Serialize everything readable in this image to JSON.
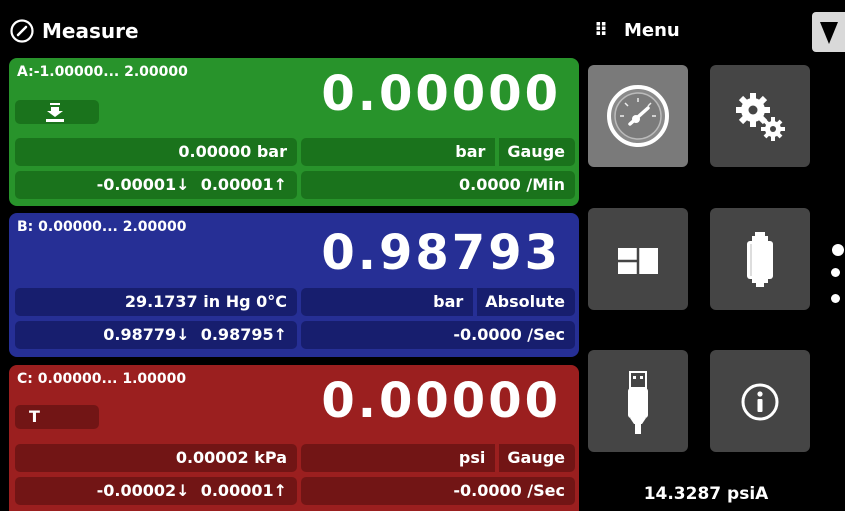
{
  "header": {
    "title": "Measure",
    "menu_label": "Menu",
    "menu_dots": "⠿",
    "dropdown_icon": "down-triangle-icon"
  },
  "channels": [
    {
      "id": "A",
      "range": "A:-1.00000... 2.00000",
      "reading": "0.00000",
      "aux_value": "0.00000 bar",
      "unit": "bar",
      "mode": "Gauge",
      "min": "-0.00001↓",
      "max": "0.00001↑",
      "rate": "0.0000 /Min",
      "button_icon": "tare-arrow-icon",
      "color": "#28932b"
    },
    {
      "id": "B",
      "range": "B: 0.00000... 2.00000",
      "reading": "0.98793",
      "aux_value": "29.1737 in Hg 0°C",
      "unit": "bar",
      "mode": "Absolute",
      "min": "0.98779↓",
      "max": "0.98795↑",
      "rate": "-0.0000 /Sec",
      "color": "#262f95"
    },
    {
      "id": "C",
      "range": "C: 0.00000... 1.00000",
      "reading": "0.00000",
      "button_label": "T",
      "aux_value": "0.00002 kPa",
      "unit": "psi",
      "mode": "Gauge",
      "min": "-0.00002↓",
      "max": "0.00001↑",
      "rate": "-0.0000 /Sec",
      "color": "#9b1f1f"
    }
  ],
  "menu_tiles": [
    {
      "name": "measure",
      "icon": "gauge-icon",
      "selected": true
    },
    {
      "name": "settings",
      "icon": "gears-icon",
      "selected": false
    },
    {
      "name": "display",
      "icon": "display-layout-icon",
      "selected": false
    },
    {
      "name": "sensor",
      "icon": "transducer-icon",
      "selected": false
    },
    {
      "name": "usb",
      "icon": "usb-icon",
      "selected": false
    },
    {
      "name": "info",
      "icon": "info-icon",
      "selected": false
    }
  ],
  "barometer": "14.3287 psiA"
}
